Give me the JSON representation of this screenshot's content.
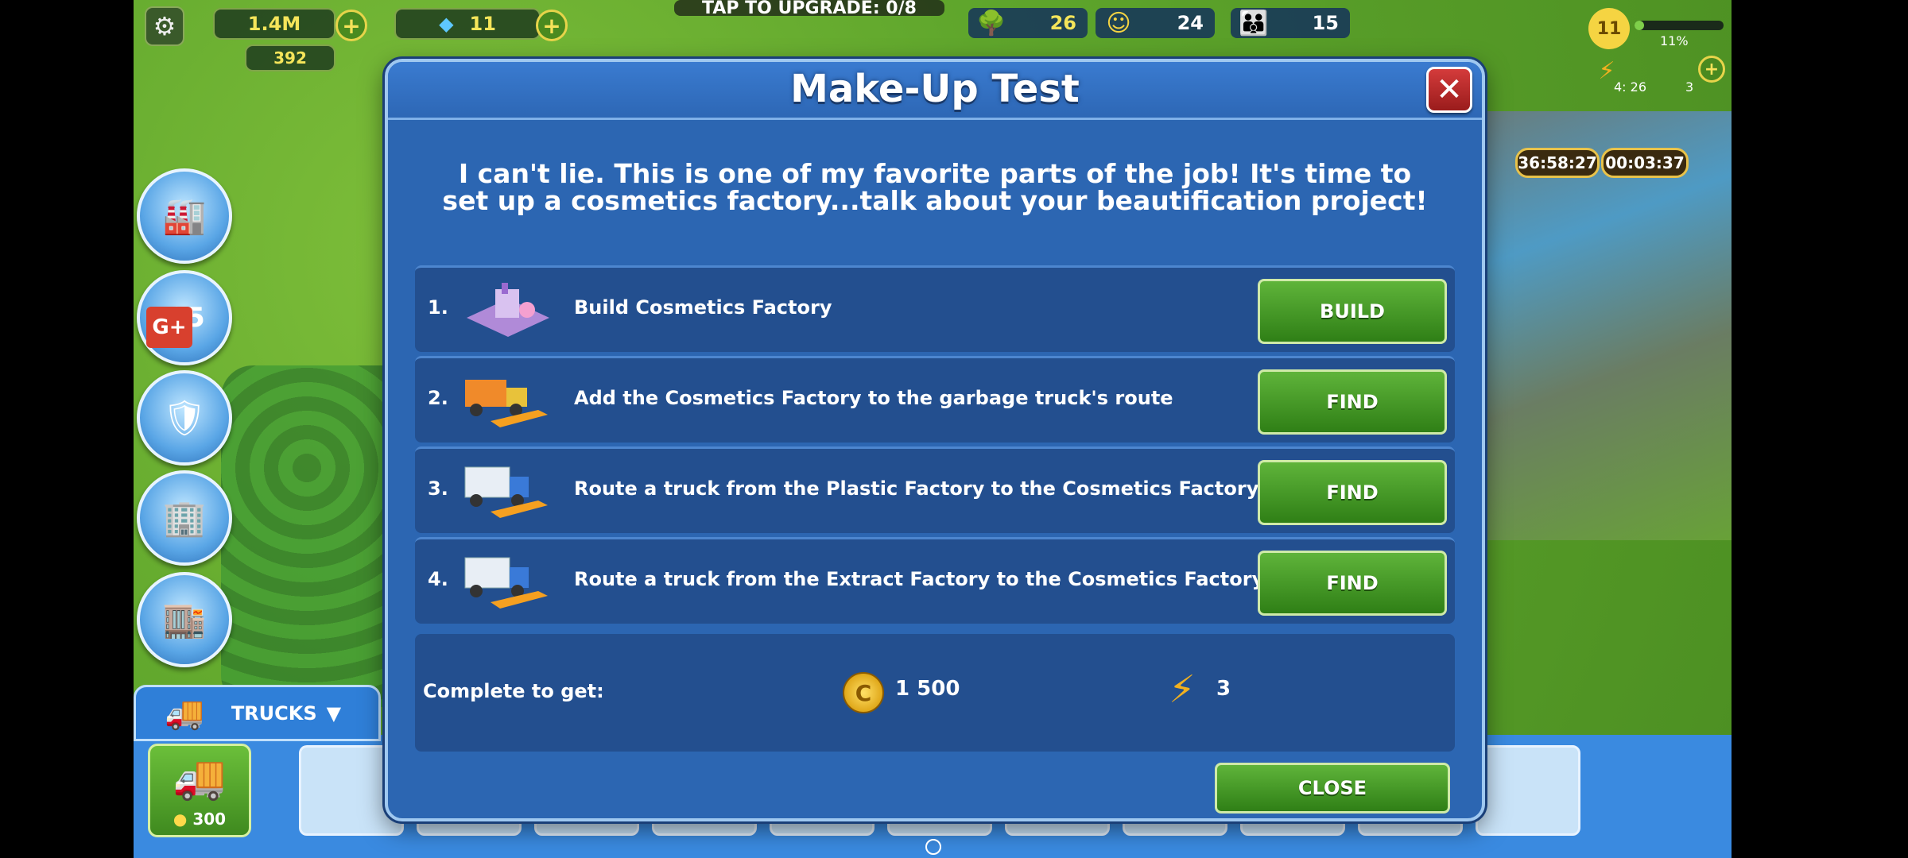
{
  "top_bar": {
    "coins": "1.4M",
    "gems": "11",
    "tokens": "392",
    "upgrade_banner": "TAP TO UPGRADE: 0/8",
    "ecology": "26",
    "happiness": "24",
    "population": "15",
    "level": "11",
    "xp_percent": "11%",
    "energy_timer": "4: 26",
    "energy": "3",
    "timer_left": "36:58:27",
    "timer_right": "00:03:37"
  },
  "side_menu": {
    "g5_badge": "G5",
    "google_plus": "G+"
  },
  "trucks_panel": {
    "tab_label": "TRUCKS",
    "add_truck_price": "300"
  },
  "dialog": {
    "title": "Make-Up Test",
    "intro": "I can't lie. This is one of my favorite parts of the job! It's time to set up a cosmetics factory...talk about your beautification project!",
    "tasks": [
      {
        "num": "1.",
        "label": "Build Cosmetics Factory",
        "button": "BUILD",
        "icon": "factory-icon"
      },
      {
        "num": "2.",
        "label": "Add the Cosmetics Factory to the garbage truck's route",
        "button": "FIND",
        "icon": "garbage-truck-icon"
      },
      {
        "num": "3.",
        "label": "Route a truck from the Plastic Factory to the Cosmetics Factory",
        "button": "FIND",
        "icon": "truck-icon"
      },
      {
        "num": "4.",
        "label": "Route a truck from the Extract Factory to the Cosmetics Factory",
        "button": "FIND",
        "icon": "truck-icon"
      }
    ],
    "reward": {
      "label": "Complete to get:",
      "coins": "1 500",
      "energy": "3"
    },
    "close_button": "CLOSE"
  }
}
